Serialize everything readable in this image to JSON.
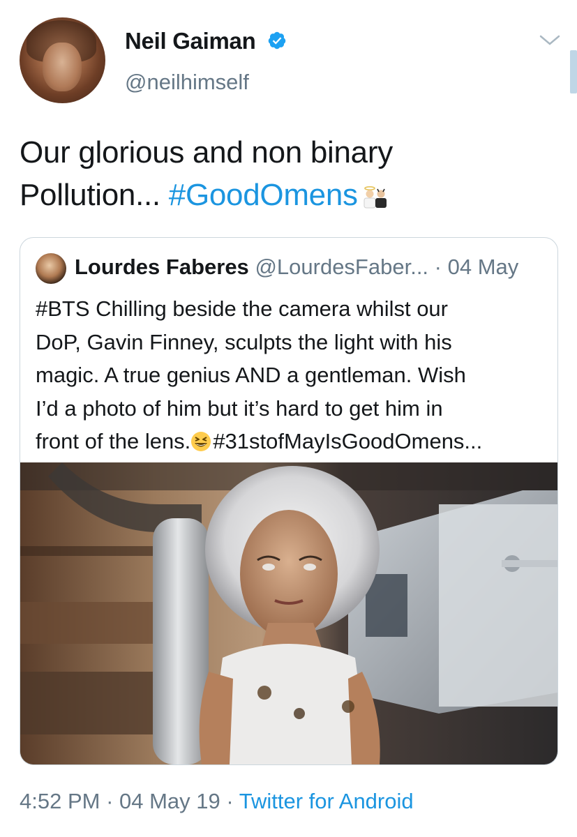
{
  "author": {
    "display_name": "Neil Gaiman",
    "handle": "@neilhimself",
    "verified": true,
    "avatar_icon": "profile-photo"
  },
  "tweet": {
    "line1": "Our glorious and non binary",
    "line2_text": "Pollution... ",
    "hashtag": "#GoodOmens",
    "emoji": "angel-devil-emoji"
  },
  "quoted": {
    "display_name": "Lourdes Faberes",
    "handle": "@LourdesFaber...",
    "separator": " · ",
    "date": "04 May",
    "lines": [
      "#BTS Chilling beside the camera whilst our",
      "DoP, Gavin Finney, sculpts the light with his",
      "magic. A true genius AND a gentleman. Wish",
      "I’d a photo of him but it’s hard to get him in"
    ],
    "last_line_start": "front of the lens.",
    "last_line_end": "#31stofMayIsGoodOmens...",
    "emoji": "grinning-squinting-face-emoji"
  },
  "footer": {
    "time": "4:52 PM",
    "sep1": " · ",
    "date": "04 May 19",
    "sep2": " · ",
    "source": "Twitter for Android"
  },
  "colors": {
    "link": "#1b95e0",
    "secondary_text": "#657786",
    "border": "#ccd6dd",
    "verified_badge": "#1da1f2"
  }
}
